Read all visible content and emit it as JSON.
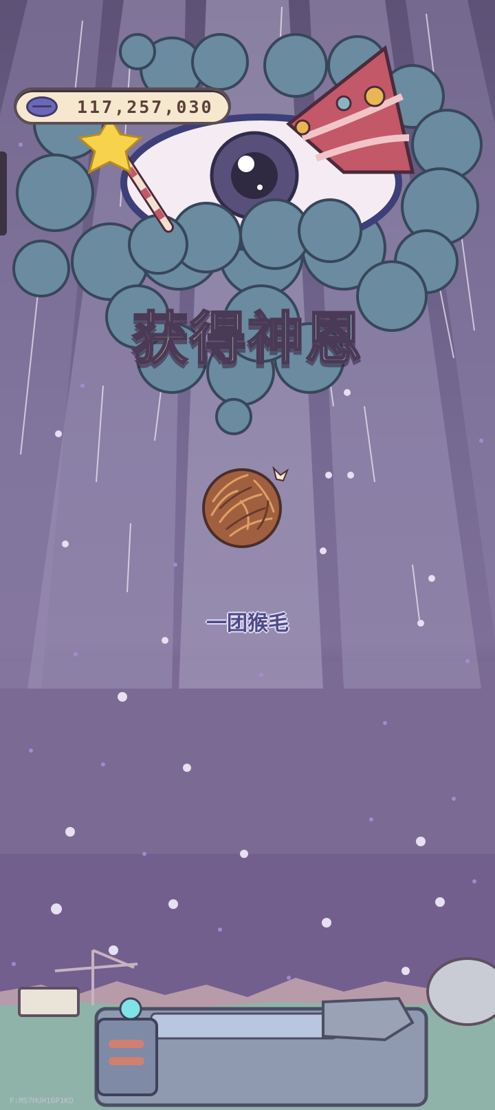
{
  "currency": {
    "icon": "cosmic-coin-icon",
    "value": "117,257,030"
  },
  "reward": {
    "title": "获得神恩",
    "item_name": "一团猴毛",
    "item_icon": "monkey-hair-ball-icon"
  },
  "corner_code": "F:MS7HUH16P1KO",
  "colors": {
    "sky": "#6f6088",
    "cloud": "#6a8ba0",
    "eye_pupil": "#58507a",
    "title_gradient": [
      "#f3a6c9",
      "#f7d08a",
      "#b6f0c6",
      "#a6c8f7",
      "#e5b6f5"
    ],
    "item_text": "#4c4b88"
  }
}
